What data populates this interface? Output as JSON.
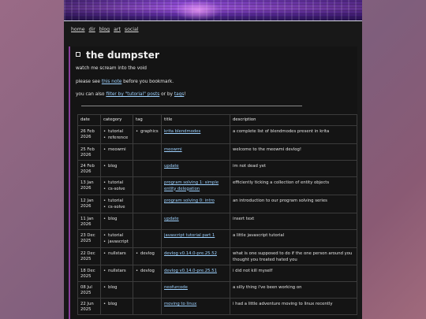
{
  "nav": [
    "home",
    "dir",
    "blog",
    "art",
    "social"
  ],
  "title": "the dumpster",
  "tagline": "watch me scream into the void",
  "notice": {
    "before": "please see ",
    "link": "this note",
    "after": " before you bookmark."
  },
  "filter": {
    "before": "you can also ",
    "link1": "filter by \"tutorial\" posts",
    "middle": " or by ",
    "link2": "tags",
    "after": "!"
  },
  "table": {
    "headers": [
      "date",
      "category",
      "tag",
      "title",
      "description"
    ],
    "rows": [
      {
        "date": "26 Feb 2026",
        "category": [
          "tutorial",
          "reference"
        ],
        "tag": [
          "graphics"
        ],
        "title": "krita blendmodes",
        "description": "a complete list of blendmodes present in krita"
      },
      {
        "date": "25 Feb 2026",
        "category": [
          "meowmi"
        ],
        "tag": [],
        "title": "meowmi",
        "description": "welcome to the meowmi devlog!"
      },
      {
        "date": "24 Feb 2026",
        "category": [
          "blog"
        ],
        "tag": [],
        "title": "update",
        "description": "im not dead yet"
      },
      {
        "date": "13 Jan 2026",
        "category": [
          "tutorial",
          "cs-solve"
        ],
        "tag": [],
        "title": "program solving 1: simple entity delegation",
        "description": "efficiently ticking a collection of entity objects"
      },
      {
        "date": "12 Jan 2026",
        "category": [
          "tutorial",
          "cs-solve"
        ],
        "tag": [],
        "title": "program solving 0: intro",
        "description": "an introduction to our program solving series"
      },
      {
        "date": "11 Jan 2026",
        "category": [
          "blog"
        ],
        "tag": [],
        "title": "update",
        "description": "insert text"
      },
      {
        "date": "23 Dec 2025",
        "category": [
          "tutorial",
          "javascript"
        ],
        "tag": [],
        "title": "javascript tutorial part 1",
        "description": "a little javascript tutorial"
      },
      {
        "date": "22 Dec 2025",
        "category": [
          "nullstars"
        ],
        "tag": [
          "devlog"
        ],
        "title": "devlog v0.14.0-pre.25.52",
        "description": "what is one supposed to do if the one person around you thought you treated hated you"
      },
      {
        "date": "18 Dec 2025",
        "category": [
          "nullstars"
        ],
        "tag": [
          "devlog"
        ],
        "title": "devlog v0.14.0-pre.25.51",
        "description": "i did not kill myself"
      },
      {
        "date": "08 Jul 2025",
        "category": [
          "blog"
        ],
        "tag": [],
        "title": "neofurcode",
        "description": "a silly thing i've been working on"
      },
      {
        "date": "22 Jun 2025",
        "category": [
          "blog"
        ],
        "tag": [],
        "title": "moving to linux",
        "description": "i had a little adventure moving to linux recently"
      }
    ]
  }
}
